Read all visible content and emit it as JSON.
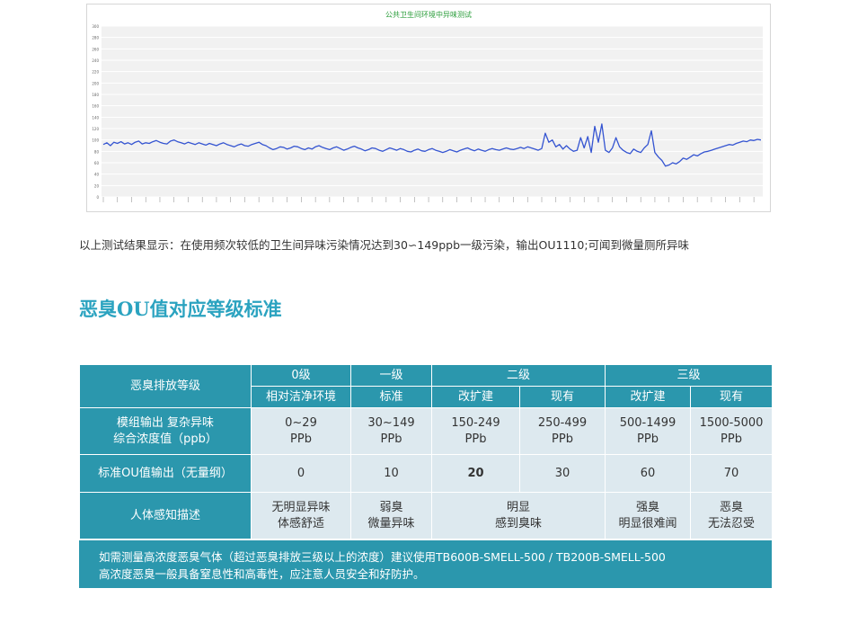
{
  "chart": {
    "chart_data": {
      "type": "line",
      "title": "公共卫生间环境中异味测试",
      "ylim": [
        0,
        300
      ],
      "yticks": [
        "0",
        "20",
        "40",
        "60",
        "80",
        "100",
        "120",
        "140",
        "160",
        "180",
        "200",
        "220",
        "240",
        "260",
        "280",
        "300"
      ],
      "line_color": "#3454d1",
      "grid": true,
      "series": [
        {
          "values": [
            92,
            95,
            90,
            96,
            94,
            97,
            93,
            95,
            92,
            96,
            98,
            93,
            95,
            94,
            97,
            99,
            96,
            94,
            93,
            98,
            100,
            97,
            95,
            93,
            96,
            94,
            92,
            95,
            93,
            91,
            94,
            92,
            90,
            93,
            95,
            92,
            90,
            88,
            91,
            93,
            90,
            89,
            92,
            94,
            96,
            92,
            90,
            86,
            83,
            85,
            88,
            87,
            84,
            86,
            89,
            88,
            85,
            83,
            86,
            84,
            88,
            90,
            87,
            85,
            83,
            86,
            88,
            85,
            82,
            84,
            87,
            89,
            86,
            84,
            81,
            83,
            86,
            85,
            82,
            80,
            83,
            86,
            84,
            82,
            85,
            83,
            80,
            79,
            82,
            84,
            81,
            80,
            83,
            85,
            82,
            80,
            78,
            80,
            83,
            81,
            79,
            82,
            84,
            86,
            83,
            81,
            84,
            82,
            80,
            83,
            85,
            83,
            82,
            84,
            86,
            84,
            83,
            85,
            87,
            85,
            88,
            86,
            84,
            82,
            85,
            112,
            96,
            100,
            88,
            92,
            84,
            90,
            84,
            80,
            82,
            104,
            86,
            106,
            78,
            124,
            96,
            128,
            82,
            78,
            86,
            104,
            88,
            82,
            78,
            76,
            84,
            80,
            78,
            86,
            92,
            116,
            78,
            70,
            64,
            54,
            56,
            60,
            58,
            62,
            68,
            66,
            70,
            74,
            72,
            76,
            79,
            80,
            82,
            84,
            86,
            88,
            90,
            92,
            91,
            94,
            96,
            98,
            97,
            100,
            99,
            101,
            100
          ]
        }
      ]
    }
  },
  "description": "以上测试结果显示：在使用频次较低的卫生间异味污染情况达到30∽149ppb一级污染，输出OU1110;可闻到微量厕所异味",
  "section_title": "恶臭OU值对应等级标准",
  "table": {
    "row_label_grade": "恶臭排放等级",
    "grades": [
      "0级",
      "一级",
      "二级",
      "三级"
    ],
    "sub_headers": [
      "相对洁净环境",
      "标准",
      "改扩建",
      "现有",
      "改扩建",
      "现有"
    ],
    "row_label_conc_line1": "模组输出 复杂异味",
    "row_label_conc_line2": "综合浓度值（ppb）",
    "conc_values": [
      "0~29",
      "30~149",
      "150-249",
      "250-499",
      "500-1499",
      "1500-5000"
    ],
    "unit": "PPb",
    "row_label_ou": "标准OU值输出（无量纲）",
    "ou_values": [
      "0",
      "10",
      "20",
      "30",
      "60",
      "70"
    ],
    "row_label_perception": "人体感知描述",
    "perception": [
      {
        "line1": "无明显异味",
        "line2": "体感舒适"
      },
      {
        "line1": "弱臭",
        "line2": "微量异味"
      },
      {
        "line1": "明显",
        "line2": "感到臭味"
      },
      {
        "line1": "强臭",
        "line2": "明显很难闻"
      },
      {
        "line1": "恶臭",
        "line2": "无法忍受"
      }
    ]
  },
  "note": {
    "line1": "如需测量高浓度恶臭气体（超过恶臭排放三级以上的浓度）建议使用TB600B-SMELL-500 / TB200B-SMELL-500",
    "line2": "高浓度恶臭一般具备窒息性和高毒性，应注意人员安全和好防护。"
  }
}
